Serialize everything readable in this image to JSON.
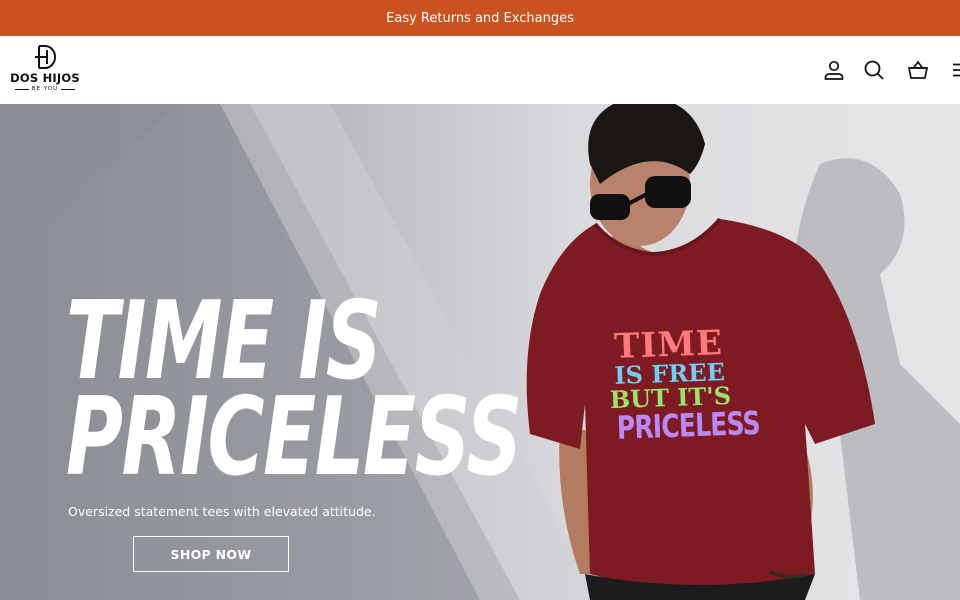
{
  "announcement": {
    "text": "Easy Returns and Exchanges"
  },
  "header": {
    "logo": {
      "name": "DOS HIJOS",
      "tagline": "BE YOU"
    },
    "icons": [
      "account-icon",
      "search-icon",
      "cart-icon",
      "menu-icon"
    ]
  },
  "hero": {
    "headline_line1": "TIME IS",
    "headline_line2": "PRICELESS",
    "subtext": "Oversized statement tees with elevated attitude.",
    "cta_label": "SHOP NOW",
    "tee_print": {
      "line1": "TIME",
      "line2": "IS FREE",
      "line3": "BUT IT'S",
      "line4": "PRICELESS"
    }
  },
  "colors": {
    "announcement_bg": "#c9521f",
    "tee": "#7e1a22"
  }
}
